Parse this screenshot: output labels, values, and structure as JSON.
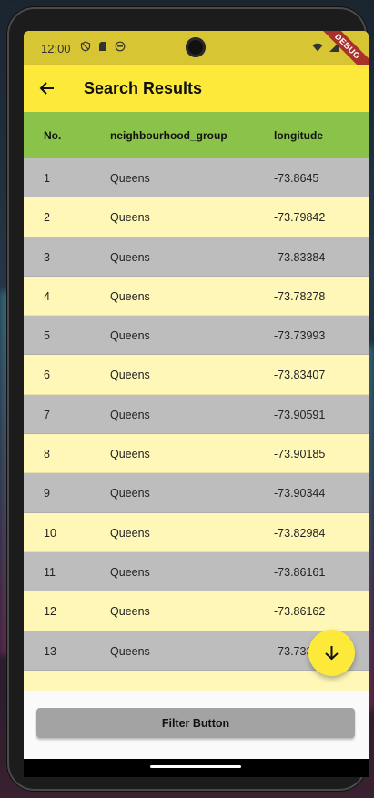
{
  "status_bar": {
    "time": "12:00",
    "icons_left": [
      "shield-icon",
      "sd-card-icon",
      "face-icon"
    ],
    "icons_right": [
      "wifi-icon",
      "signal-icon",
      "battery-icon"
    ],
    "debug_banner": "DEBUG"
  },
  "app_bar": {
    "title": "Search Results",
    "back_icon": "arrow-left-icon",
    "background": "#fde93a"
  },
  "table": {
    "headers": [
      "No.",
      "neighbourhood_group",
      "longitude"
    ],
    "header_color": "#8bc34a",
    "row_colors": [
      "#bdbdbd",
      "#fef7b8"
    ],
    "rows": [
      [
        "1",
        "Queens",
        "-73.8645"
      ],
      [
        "2",
        "Queens",
        "-73.79842"
      ],
      [
        "3",
        "Queens",
        "-73.83384"
      ],
      [
        "4",
        "Queens",
        "-73.78278"
      ],
      [
        "5",
        "Queens",
        "-73.73993"
      ],
      [
        "6",
        "Queens",
        "-73.83407"
      ],
      [
        "7",
        "Queens",
        "-73.90591"
      ],
      [
        "8",
        "Queens",
        "-73.90185"
      ],
      [
        "9",
        "Queens",
        "-73.90344"
      ],
      [
        "10",
        "Queens",
        "-73.82984"
      ],
      [
        "11",
        "Queens",
        "-73.86161"
      ],
      [
        "12",
        "Queens",
        "-73.86162"
      ],
      [
        "13",
        "Queens",
        "-73.733"
      ],
      [
        "",
        "",
        ""
      ]
    ]
  },
  "fab": {
    "icon": "arrow-down-icon"
  },
  "filter_button": {
    "label": "Filter Button"
  }
}
